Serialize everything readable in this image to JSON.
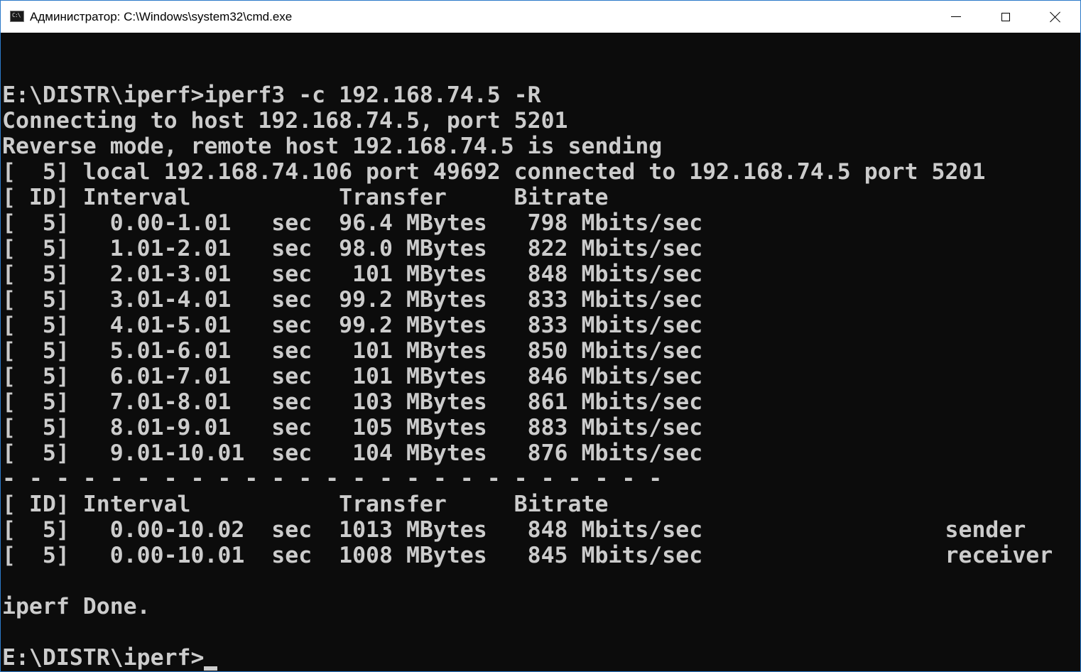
{
  "window": {
    "title": "Администратор: C:\\Windows\\system32\\cmd.exe",
    "icon": "cmd-console-icon",
    "icon_glyph": "C:\\",
    "controls": {
      "minimize": "minimize-icon",
      "maximize": "maximize-icon",
      "close": "close-icon"
    }
  },
  "console": {
    "foreground": "#cccccc",
    "background": "#0c0c0c",
    "lines": [
      "",
      "E:\\DISTR\\iperf>iperf3 -c 192.168.74.5 -R",
      "Connecting to host 192.168.74.5, port 5201",
      "Reverse mode, remote host 192.168.74.5 is sending",
      "[  5] local 192.168.74.106 port 49692 connected to 192.168.74.5 port 5201",
      "[ ID] Interval           Transfer     Bitrate",
      "[  5]   0.00-1.01   sec  96.4 MBytes   798 Mbits/sec",
      "[  5]   1.01-2.01   sec  98.0 MBytes   822 Mbits/sec",
      "[  5]   2.01-3.01   sec   101 MBytes   848 Mbits/sec",
      "[  5]   3.01-4.01   sec  99.2 MBytes   833 Mbits/sec",
      "[  5]   4.01-5.01   sec  99.2 MBytes   833 Mbits/sec",
      "[  5]   5.01-6.01   sec   101 MBytes   850 Mbits/sec",
      "[  5]   6.01-7.01   sec   101 MBytes   846 Mbits/sec",
      "[  5]   7.01-8.01   sec   103 MBytes   861 Mbits/sec",
      "[  5]   8.01-9.01   sec   105 MBytes   883 Mbits/sec",
      "[  5]   9.01-10.01  sec   104 MBytes   876 Mbits/sec",
      "- - - - - - - - - - - - - - - - - - - - - - - - -",
      "[ ID] Interval           Transfer     Bitrate",
      "[  5]   0.00-10.02  sec  1013 MBytes   848 Mbits/sec                  sender",
      "[  5]   0.00-10.01  sec  1008 MBytes   845 Mbits/sec                  receiver",
      "",
      "iperf Done.",
      "",
      "E:\\DISTR\\iperf>"
    ]
  }
}
